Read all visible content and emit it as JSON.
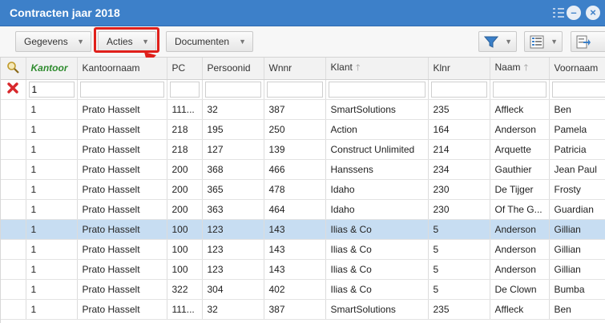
{
  "window": {
    "title": "Contracten jaar 2018"
  },
  "toolbar": {
    "gegevens_label": "Gegevens",
    "acties_label": "Acties",
    "documenten_label": "Documenten"
  },
  "colors": {
    "accent": "#3d80c9",
    "highlight": "#e0201b",
    "selected_row": "#c7ddf2"
  },
  "grid": {
    "columns": [
      {
        "label": "Kantoor"
      },
      {
        "label": "Kantoornaam"
      },
      {
        "label": "PC"
      },
      {
        "label": "Persoonid"
      },
      {
        "label": "Wnnr"
      },
      {
        "label": "Klant"
      },
      {
        "label": "Klnr"
      },
      {
        "label": "Naam"
      },
      {
        "label": "Voornaam"
      }
    ],
    "filter": {
      "kantoor": "1"
    },
    "rows": [
      [
        "1",
        "Prato Hasselt",
        "111...",
        "32",
        "387",
        "SmartSolutions",
        "235",
        "Affleck",
        "Ben"
      ],
      [
        "1",
        "Prato Hasselt",
        "218",
        "195",
        "250",
        "Action",
        "164",
        "Anderson",
        "Pamela"
      ],
      [
        "1",
        "Prato Hasselt",
        "218",
        "127",
        "139",
        "Construct Unlimited",
        "214",
        "Arquette",
        "Patricia"
      ],
      [
        "1",
        "Prato Hasselt",
        "200",
        "368",
        "466",
        "Hanssens",
        "234",
        "Gauthier",
        "Jean Paul"
      ],
      [
        "1",
        "Prato Hasselt",
        "200",
        "365",
        "478",
        "Idaho",
        "230",
        "De Tijger",
        "Frosty"
      ],
      [
        "1",
        "Prato Hasselt",
        "200",
        "363",
        "464",
        "Idaho",
        "230",
        "Of The G...",
        "Guardian"
      ],
      [
        "1",
        "Prato Hasselt",
        "100",
        "123",
        "143",
        "Ilias & Co",
        "5",
        "Anderson",
        "Gillian"
      ],
      [
        "1",
        "Prato Hasselt",
        "100",
        "123",
        "143",
        "Ilias & Co",
        "5",
        "Anderson",
        "Gillian"
      ],
      [
        "1",
        "Prato Hasselt",
        "100",
        "123",
        "143",
        "Ilias & Co",
        "5",
        "Anderson",
        "Gillian"
      ],
      [
        "1",
        "Prato Hasselt",
        "322",
        "304",
        "402",
        "Ilias & Co",
        "5",
        "De Clown",
        "Bumba"
      ],
      [
        "1",
        "Prato Hasselt",
        "111...",
        "32",
        "387",
        "SmartSolutions",
        "235",
        "Affleck",
        "Ben"
      ]
    ],
    "selected_row_index": 6
  }
}
